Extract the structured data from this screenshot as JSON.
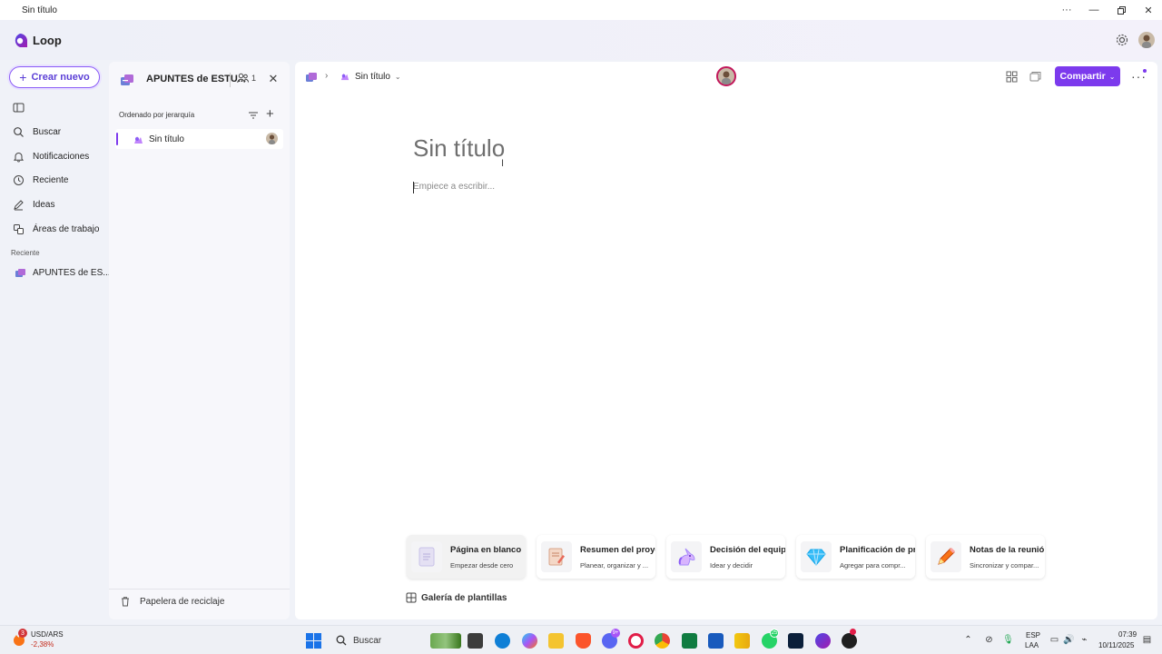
{
  "window": {
    "title": "Sin título",
    "controls": [
      "more-options",
      "minimize",
      "restore",
      "close"
    ]
  },
  "app": {
    "name": "Loop",
    "brand_color": "#7c3aed"
  },
  "left_nav": {
    "create_label": "Crear nuevo",
    "items": [
      {
        "icon": "pane-icon",
        "label": ""
      },
      {
        "icon": "search-icon",
        "label": "Buscar"
      },
      {
        "icon": "bell-icon",
        "label": "Notificaciones"
      },
      {
        "icon": "clock-icon",
        "label": "Reciente"
      },
      {
        "icon": "pen-icon",
        "label": "Ideas"
      },
      {
        "icon": "workspaces-icon",
        "label": "Áreas de trabajo"
      }
    ],
    "recent_label": "Reciente",
    "recent_items": [
      {
        "label": "APUNTES de ES..."
      }
    ]
  },
  "tree": {
    "workspace_title": "APUNTES de ESTU...",
    "members_count": "1",
    "sort_label": "Ordenado por jerarquía",
    "pages": [
      {
        "label": "Sin título"
      }
    ],
    "trash_label": "Papelera de reciclaje"
  },
  "canvas": {
    "breadcrumb_page": "Sin título",
    "share_label": "Compartir",
    "doc_title": "Sin título",
    "doc_placeholder": "Empiece a escribir...",
    "templates": [
      {
        "title": "Página en blanco",
        "subtitle": "Empezar desde cero",
        "icon": "blank-page-icon"
      },
      {
        "title": "Resumen del proyecto",
        "subtitle": "Planear, organizar y ...",
        "icon": "notepad-icon"
      },
      {
        "title": "Decisión del equipo",
        "subtitle": "Idear y decidir",
        "icon": "unicorn-icon"
      },
      {
        "title": "Planificación de proyectos",
        "subtitle": "Agregar para compr...",
        "icon": "diamond-icon"
      },
      {
        "title": "Notas de la reunión",
        "subtitle": "Sincronizar y compar...",
        "icon": "pencil-icon"
      }
    ],
    "gallery_label": "Galería de plantillas"
  },
  "taskbar": {
    "weather_badge": "3",
    "fx_label": "USD/ARS",
    "fx_change": "-2,38%",
    "search_label": "Buscar",
    "teams_badge": "9+",
    "whatsapp_badge": "25",
    "lang_1": "ESP",
    "lang_2": "LAA",
    "time": "07:39",
    "date": "10/11/2025"
  }
}
